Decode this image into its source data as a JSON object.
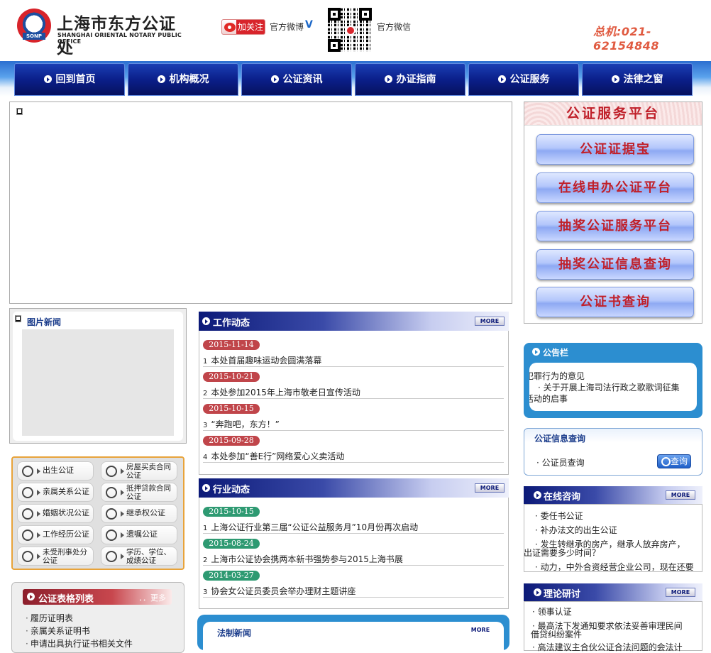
{
  "header": {
    "logo_cn": "上海市东方公证处",
    "logo_en": "SHANGHAI ORIENTAL NOTARY PUBLIC OFFICE",
    "logo_badge": "SONP",
    "follow_label": "加关注",
    "weibo_label": "官方微博",
    "wechat_label": "官方微信",
    "hotline": "总机:021-62154848"
  },
  "nav": [
    "回到首页",
    "机构概况",
    "公证资讯",
    "办证指南",
    "公证服务",
    "法律之窗"
  ],
  "platform": {
    "title": "公证服务平台",
    "buttons": [
      "公证证据宝",
      "在线申办公证平台",
      "抽奖公证服务平台",
      "抽奖公证信息查询",
      "公证书查询"
    ]
  },
  "photo_news": {
    "title": "图片新闻"
  },
  "services": [
    [
      "出生公证",
      "房屋买卖合同公证"
    ],
    [
      "亲属关系公证",
      "抵押贷款合同公证"
    ],
    [
      "婚姻状况公证",
      "继承权公证"
    ],
    [
      "工作经历公证",
      "遗嘱公证"
    ],
    [
      "未受刑事处分公证",
      "学历、学位、成绩公证"
    ]
  ],
  "forms": {
    "title": "公证表格列表",
    "more": "．．更多",
    "items": [
      "履历证明表",
      "亲属关系证明书",
      "申请出具执行证书相关文件"
    ]
  },
  "work_news": {
    "title": "工作动态",
    "more": "MORE",
    "items": [
      {
        "date": "2015-11-14",
        "num": "1",
        "text": "本处首届趣味运动会圆满落幕"
      },
      {
        "date": "2015-10-21",
        "num": "2",
        "text": "本处参加2015年上海市敬老日宣传活动"
      },
      {
        "date": "2015-10-15",
        "num": "3",
        "text": "“奔跑吧，东方！”"
      },
      {
        "date": "2015-09-28",
        "num": "4",
        "text": "本处参加“善E行”网络爱心义卖活动"
      }
    ]
  },
  "industry_news": {
    "title": "行业动态",
    "more": "MORE",
    "items": [
      {
        "date": "2015-10-15",
        "num": "1",
        "text": "上海公证行业第三届“公证公益服务月”10月份再次启动"
      },
      {
        "date": "2015-08-24",
        "num": "2",
        "text": "上海市公证协会携两本新书强势参与2015上海书展"
      },
      {
        "date": "2014-03-27",
        "num": "3",
        "text": "协会女公证员委员会举办理财主题讲座"
      }
    ]
  },
  "law_news": {
    "title": "法制新闻",
    "more": "MORE"
  },
  "notice": {
    "title": "公告栏",
    "lines": [
      "犯罪行为的意见",
      "· 关于开展上海司法行政之歌歌词征集",
      "活动的启事"
    ]
  },
  "query": {
    "title": "公证信息查询",
    "item": "· 公证员查询",
    "button": "查询"
  },
  "consult": {
    "title": "在线咨询",
    "more": "MORE",
    "lines": [
      "· 委任书公证",
      "· 补办法文的出生公证",
      "· 发生转继承的房产，继承人放弃房产，",
      "出证需要多少时间？",
      "· 动力，中外合资经营企业公司，现在还要"
    ]
  },
  "theory": {
    "title": "理论研讨",
    "more": "MORE",
    "lines": [
      "· 领事认证",
      "· 最高法下发通知要求依法妥善审理民间",
      "借贷纠纷案件",
      "· 高法建议主合伙公证合法问题的会法计"
    ]
  }
}
